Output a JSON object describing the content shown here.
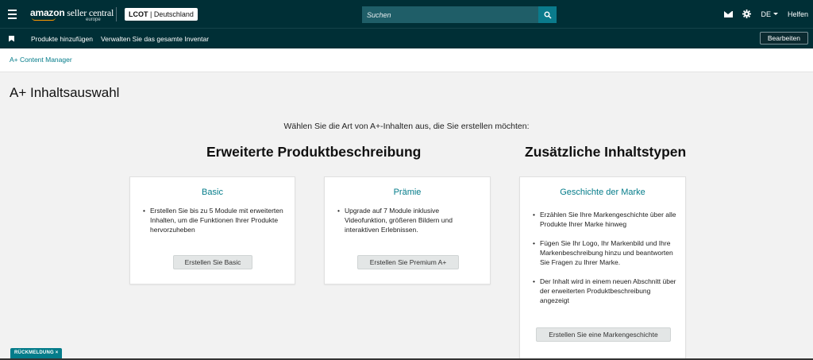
{
  "header": {
    "logo_main": "amazon",
    "logo_sub": "seller central",
    "logo_region": "europe",
    "account_code": "LCOT",
    "account_country": "Deutschland",
    "search_placeholder": "Suchen",
    "language": "DE",
    "help_label": "Helfen"
  },
  "nav": {
    "items": [
      {
        "label": "Produkte hinzufügen"
      },
      {
        "label": "Verwalten Sie das gesamte Inventar"
      }
    ],
    "edit_label": "Bearbeiten"
  },
  "breadcrumb": "A+ Content Manager",
  "page_title": "A+ Inhaltsauswahl",
  "intro": "Wählen Sie die Art von A+-Inhalten aus, die Sie erstellen möchten:",
  "sections": {
    "extended_title": "Erweiterte Produktbeschreibung",
    "additional_title": "Zusätzliche Inhaltstypen"
  },
  "cards": [
    {
      "title": "Basic",
      "bullets": [
        "Erstellen Sie bis zu 5 Module mit erweiterten Inhalten, um die Funktionen Ihrer Produkte hervorzuheben"
      ],
      "button": "Erstellen Sie Basic"
    },
    {
      "title": "Prämie",
      "bullets": [
        "Upgrade auf 7 Module inklusive Videofunktion, größeren Bildern und interaktiven Erlebnissen."
      ],
      "button": "Erstellen Sie Premium A+"
    },
    {
      "title": "Geschichte der Marke",
      "bullets": [
        "Erzählen Sie Ihre Markengeschichte über alle Produkte Ihrer Marke hinweg",
        "Fügen Sie Ihr Logo, Ihr Markenbild und Ihre Markenbeschreibung hinzu und beantworten Sie Fragen zu Ihrer Marke.",
        "Der Inhalt wird in einem neuen Abschnitt über der erweiterten Produktbeschreibung angezeigt"
      ],
      "button": "Erstellen Sie eine Markengeschichte"
    }
  ],
  "feedback_label": "RÜCKMELDUNG",
  "feedback_close": "×",
  "colors": {
    "header_bg": "#002f36",
    "accent": "#047c8a",
    "search_bg": "#1f5e68",
    "page_bg": "#f2f2f2"
  },
  "icons": [
    "menu-icon",
    "search-icon",
    "mail-icon",
    "gear-icon",
    "bookmark-icon",
    "chevron-down-icon"
  ]
}
